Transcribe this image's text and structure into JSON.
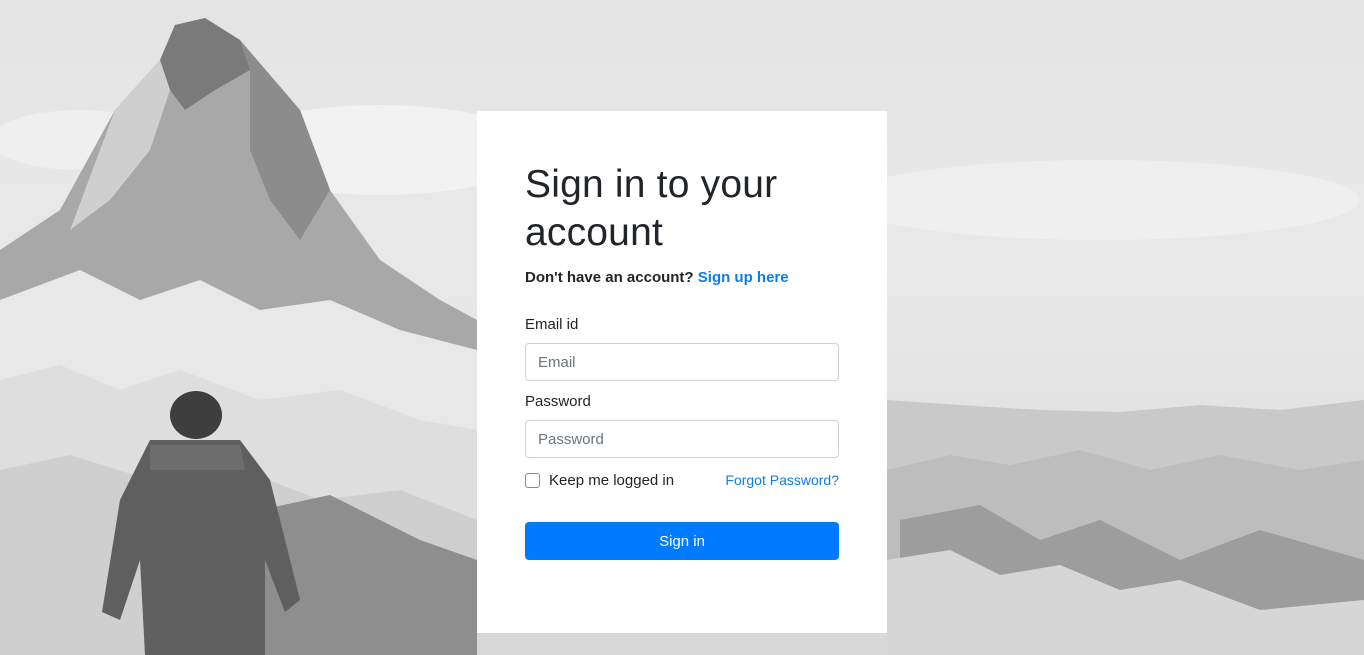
{
  "login": {
    "title": "Sign in to your account",
    "signup_prompt": "Don't have an account?",
    "signup_link": "Sign up here",
    "email_label": "Email id",
    "email_placeholder": "Email",
    "email_value": "",
    "password_label": "Password",
    "password_placeholder": "Password",
    "password_value": "",
    "keep_logged_in_label": "Keep me logged in",
    "keep_logged_in_checked": false,
    "forgot_password": "Forgot Password?",
    "sign_in_button": "Sign in"
  },
  "colors": {
    "accent": "#007bff",
    "link": "#0d7ee8",
    "card_background": "#ffffff"
  }
}
